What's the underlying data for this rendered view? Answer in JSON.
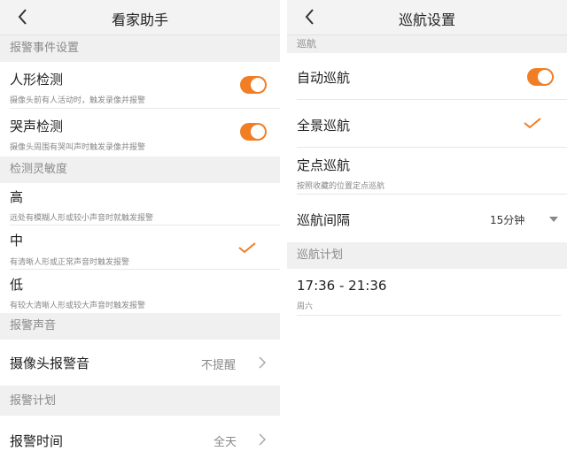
{
  "colors": {
    "accent": "#f17d24",
    "section_bg": "#f0f0f0",
    "nav_bg": "#f3f3f3"
  },
  "left": {
    "title": "看家助手",
    "section_alarm_events": "报警事件设置",
    "human_detection": {
      "title": "人形检测",
      "desc": "摄像头前有人活动时，触发录像并报警",
      "enabled": true
    },
    "cry_detection": {
      "title": "哭声检测",
      "desc": "摄像头周围有哭叫声时触发录像并报警",
      "enabled": true
    },
    "section_sensitivity": "检测灵敏度",
    "sensitivity_options": [
      {
        "title": "高",
        "desc": "远处有模糊人形或较小声音时就触发报警",
        "selected": false
      },
      {
        "title": "中",
        "desc": "有清晰人形或正常声音时触发报警",
        "selected": true
      },
      {
        "title": "低",
        "desc": "有较大清晰人形或较大声音时触发报警",
        "selected": false
      }
    ],
    "section_alarm_sound": "报警声音",
    "camera_alarm_sound": {
      "title": "摄像头报警音",
      "value": "不提醒"
    },
    "section_alarm_plan": "报警计划",
    "alarm_time": {
      "title": "报警时间",
      "value": "全天"
    }
  },
  "right": {
    "title": "巡航设置",
    "section_cruise": "巡航",
    "auto_cruise": {
      "title": "自动巡航",
      "enabled": true
    },
    "panoramic_cruise": {
      "title": "全景巡航",
      "selected": true
    },
    "fixed_point_cruise": {
      "title": "定点巡航",
      "desc": "按照收藏的位置定点巡航"
    },
    "cruise_interval": {
      "title": "巡航间隔",
      "value": "15分钟"
    },
    "section_cruise_plan": "巡航计划",
    "plan": {
      "time": "17:36 - 21:36",
      "days": "周六"
    }
  }
}
